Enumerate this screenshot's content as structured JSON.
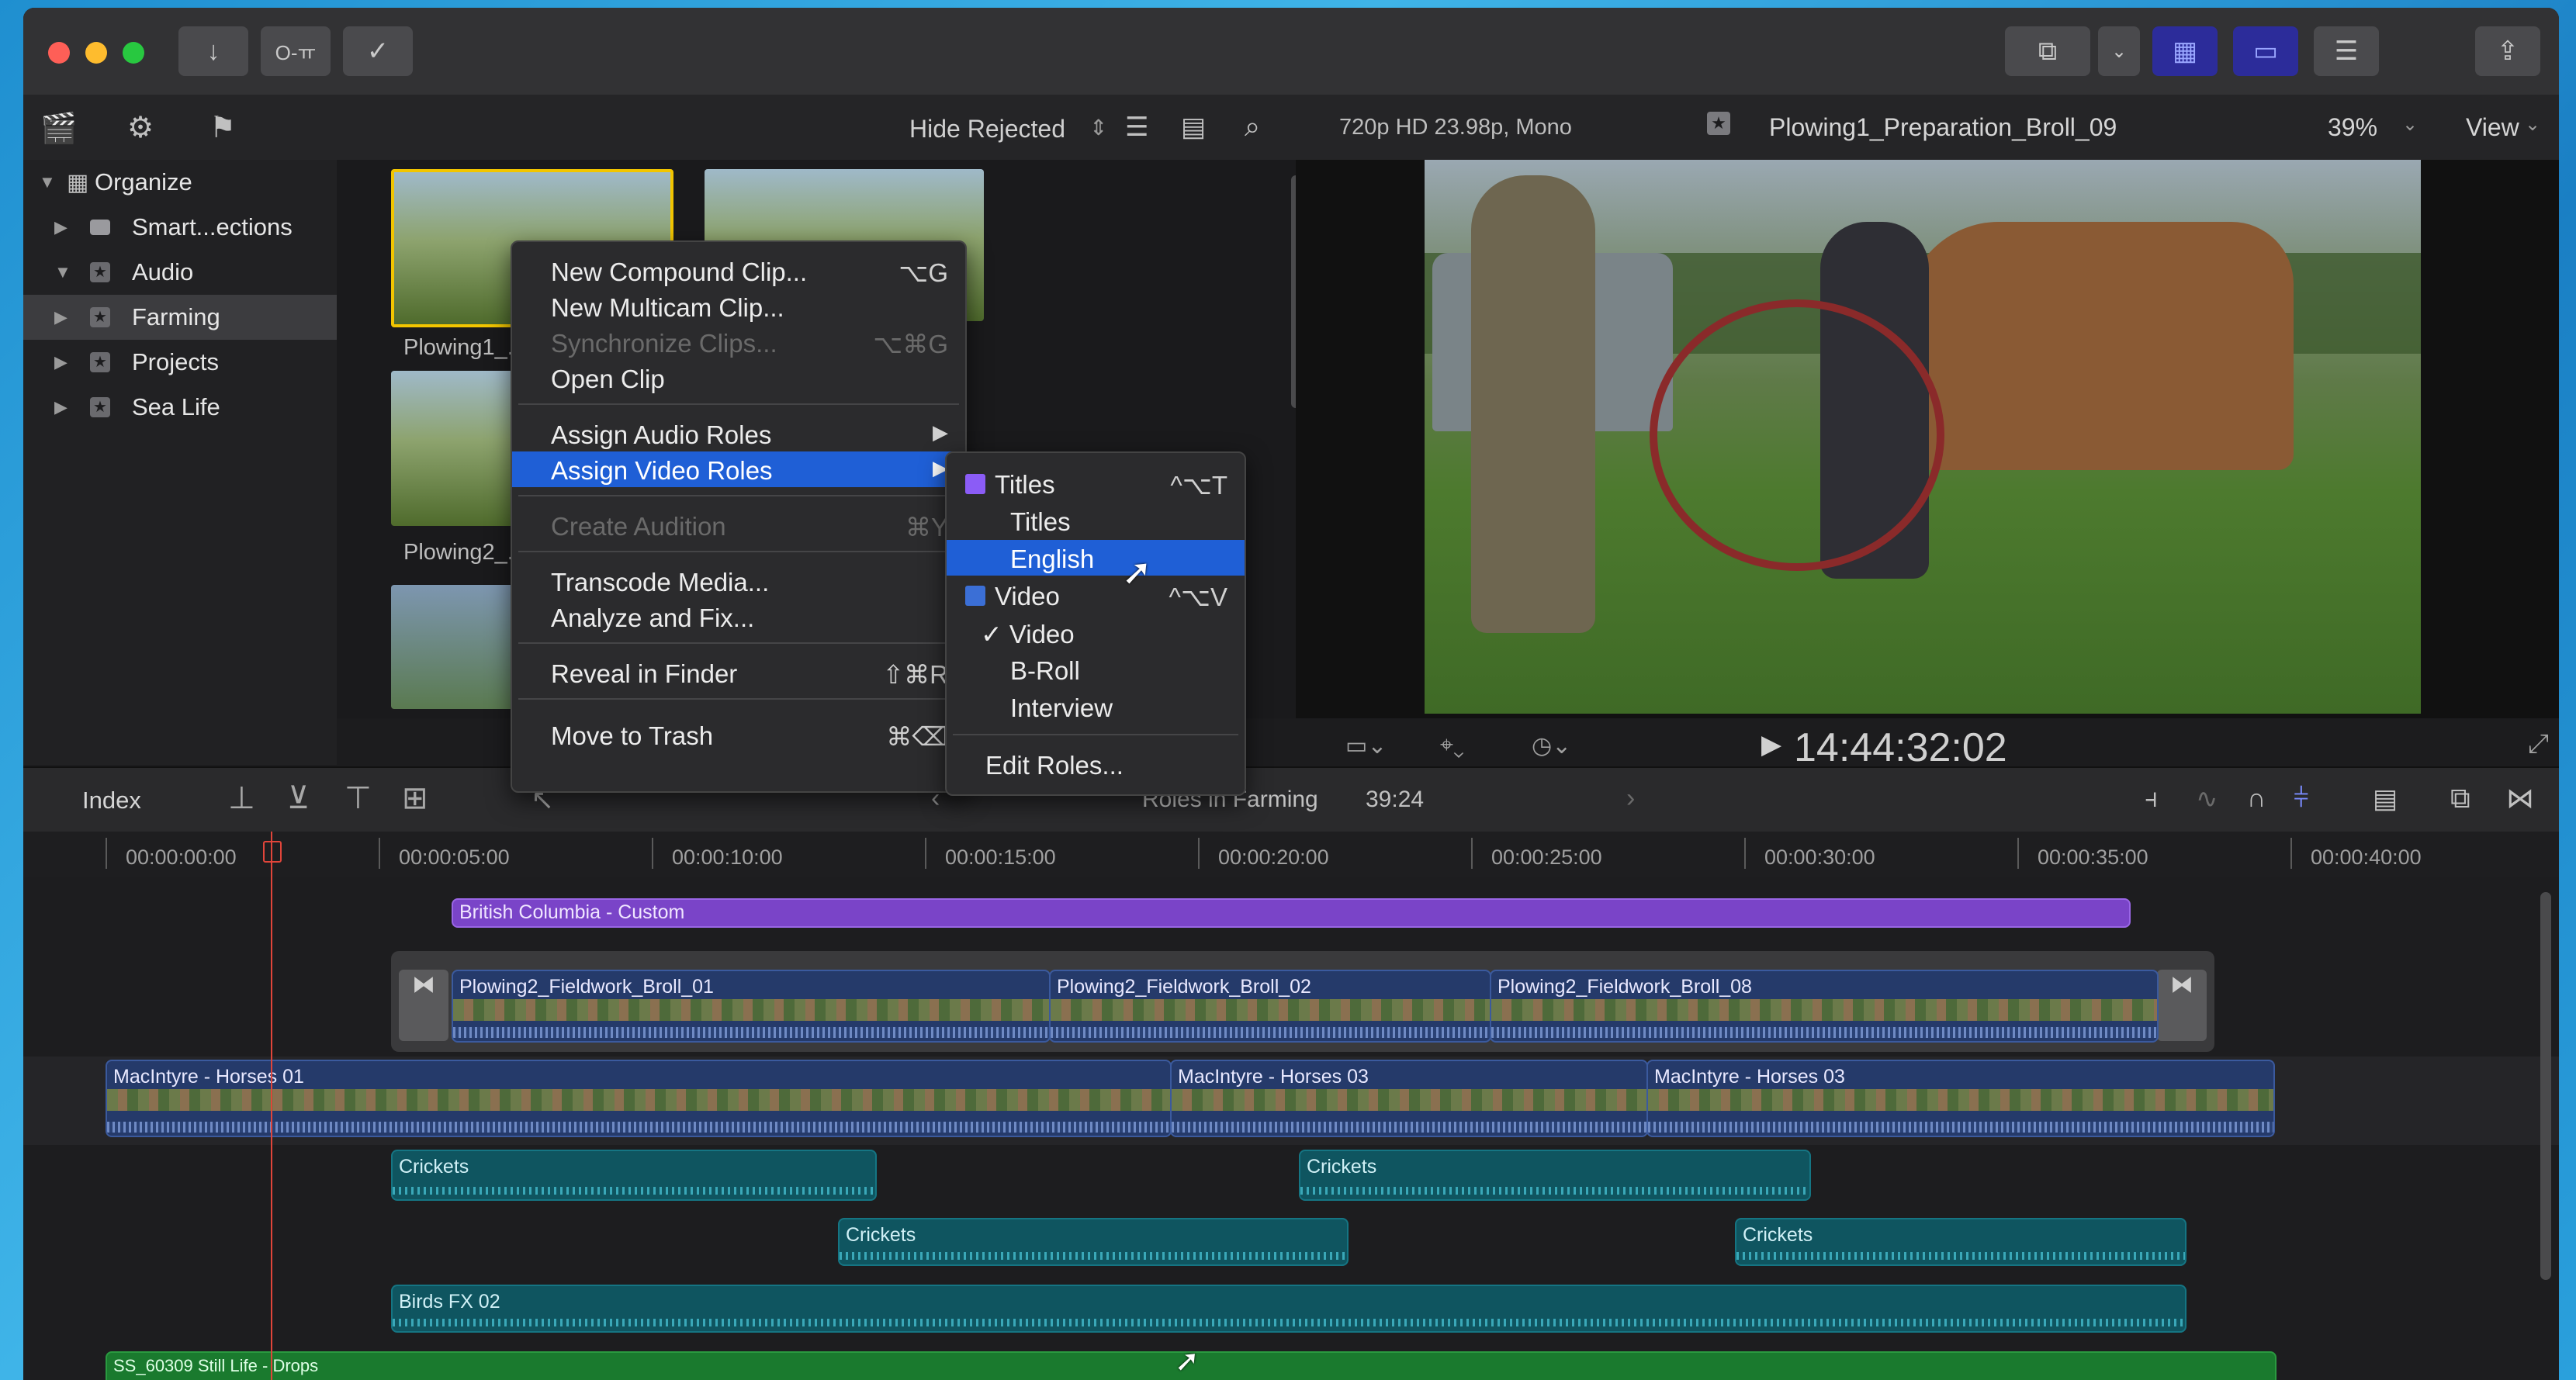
{
  "toolbar": {
    "import_icon": "↓",
    "keyword_icon": "O-ㅠ",
    "check_icon": "✓",
    "share_icon": "⇪"
  },
  "browser": {
    "filter_label": "Hide Rejected",
    "sidebar": [
      {
        "label": "Organize"
      },
      {
        "label": "Smart...ections"
      },
      {
        "label": "Audio"
      },
      {
        "label": "Farming"
      },
      {
        "label": "Projects"
      },
      {
        "label": "Sea Life"
      }
    ],
    "clips": [
      {
        "caption": "Plowing1_..."
      },
      {
        "caption": "Plowing2_..."
      }
    ]
  },
  "viewer": {
    "format": "720p HD 23.98p, Mono",
    "clip_name": "Plowing1_Preparation_Broll_09",
    "zoom": "39%",
    "view_label": "View",
    "timecode": "14:44:32:02"
  },
  "timeline": {
    "index_label": "Index",
    "title": "Roles in Farming",
    "duration": "39:24",
    "ruler": [
      "00:00:00:00",
      "00:00:05:00",
      "00:00:10:00",
      "00:00:15:00",
      "00:00:20:00",
      "00:00:25:00",
      "00:00:30:00",
      "00:00:35:00",
      "00:00:40:00"
    ],
    "title_clip": "British Columbia - Custom",
    "broll": [
      "Plowing2_Fieldwork_Broll_01",
      "Plowing2_Fieldwork_Broll_02",
      "Plowing2_Fieldwork_Broll_08"
    ],
    "primary": [
      "MacIntyre - Horses 01",
      "MacIntyre - Horses 03",
      "MacIntyre - Horses 03"
    ],
    "audio": [
      "Crickets",
      "Crickets",
      "Crickets",
      "Crickets",
      "Birds FX 02"
    ],
    "music": "SS_60309 Still Life - Drops"
  },
  "context_menu": {
    "items": [
      {
        "label": "New Compound Clip...",
        "shortcut": "⌥G"
      },
      {
        "label": "New Multicam Clip...",
        "shortcut": ""
      },
      {
        "label": "Synchronize Clips...",
        "shortcut": "⌥⌘G"
      },
      {
        "label": "Open Clip",
        "shortcut": ""
      },
      {
        "label": "Assign Audio Roles",
        "shortcut": "▶"
      },
      {
        "label": "Assign Video Roles",
        "shortcut": "▶"
      },
      {
        "label": "Create Audition",
        "shortcut": "⌘Y"
      },
      {
        "label": "Transcode Media...",
        "shortcut": ""
      },
      {
        "label": "Analyze and Fix...",
        "shortcut": ""
      },
      {
        "label": "Reveal in Finder",
        "shortcut": "⇧⌘R"
      },
      {
        "label": "Move to Trash",
        "shortcut": "⌘⌫"
      }
    ]
  },
  "roles_submenu": {
    "items": [
      {
        "label": "Titles",
        "shortcut": "^⌥T"
      },
      {
        "label": "Titles",
        "shortcut": ""
      },
      {
        "label": "English",
        "shortcut": ""
      },
      {
        "label": "Video",
        "shortcut": "^⌥V"
      },
      {
        "label": "✓ Video",
        "shortcut": ""
      },
      {
        "label": "B-Roll",
        "shortcut": ""
      },
      {
        "label": "Interview",
        "shortcut": ""
      },
      {
        "label": "Edit Roles...",
        "shortcut": ""
      }
    ],
    "colors": {
      "titles": "#8b5cf6",
      "video": "#3b6fd6"
    }
  },
  "colors": {
    "accent": "#1f5fd6",
    "playhead": "#e0453a"
  }
}
